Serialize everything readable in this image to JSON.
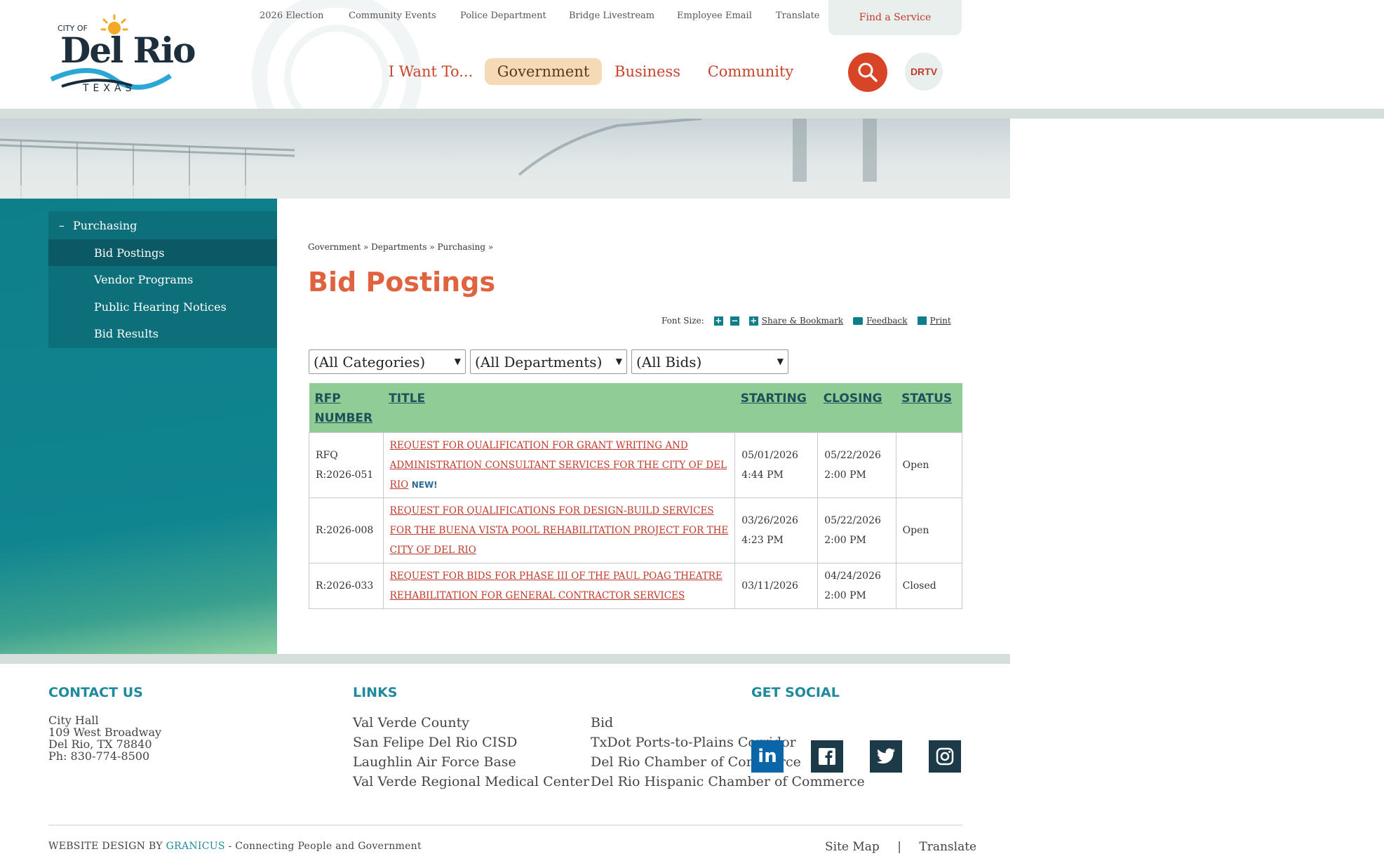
{
  "header": {
    "logo": {
      "line1": "CITY OF",
      "line2": "Del Rio",
      "line3": "TEXAS"
    },
    "utility_links": [
      "2026 Election",
      "Community Events",
      "Police Department",
      "Bridge Livestream",
      "Employee Email",
      "Translate"
    ],
    "find_service": "Find a Service",
    "main_nav": [
      "I Want To...",
      "Government",
      "Business",
      "Community"
    ],
    "drtv": "DRTV"
  },
  "sidebar": {
    "section": "Purchasing",
    "items": [
      "Bid Postings",
      "Vendor Programs",
      "Public Hearing Notices",
      "Bid Results"
    ]
  },
  "breadcrumb": [
    "Government",
    "Departments",
    "Purchasing"
  ],
  "page_title": "Bid Postings",
  "tools": {
    "font_size": "Font Size:",
    "share": "Share & Bookmark",
    "feedback": "Feedback",
    "print": "Print"
  },
  "filters": [
    "(All Categories)",
    "(All Departments)",
    "(All Bids)"
  ],
  "table": {
    "headers": [
      "RFP NUMBER",
      "TITLE",
      "STARTING",
      "CLOSING",
      "STATUS"
    ],
    "rows": [
      {
        "number": "RFQ R:2026-051",
        "title": "REQUEST FOR QUALIFICATION FOR GRANT WRITING AND ADMINISTRATION CONSULTANT SERVICES FOR THE CITY OF DEL RIO",
        "new": "NEW!",
        "start_date": "05/01/2026",
        "start_time": "4:44 PM",
        "close_date": "05/22/2026",
        "close_time": "2:00 PM",
        "status": "Open"
      },
      {
        "number": "R:2026-008",
        "title": "REQUEST FOR QUALIFICATIONS FOR DESIGN-BUILD SERVICES FOR THE BUENA VISTA POOL REHABILITATION PROJECT FOR THE CITY OF DEL RIO",
        "new": "",
        "start_date": "03/26/2026",
        "start_time": "4:23 PM",
        "close_date": "05/22/2026",
        "close_time": "2:00 PM",
        "status": "Open"
      },
      {
        "number": "R:2026-033",
        "title": "REQUEST FOR BIDS FOR PHASE III OF THE PAUL POAG THEATRE REHABILITATION FOR GENERAL CONTRACTOR SERVICES",
        "new": "",
        "start_date": "03/11/2026",
        "start_time": "",
        "close_date": "04/24/2026",
        "close_time": "2:00 PM",
        "status": "Closed"
      }
    ]
  },
  "footer": {
    "contact_heading": "CONTACT US",
    "contact_lines": [
      "City Hall",
      "109 West Broadway",
      "Del Rio, TX 78840",
      "Ph: 830-774-8500"
    ],
    "links_heading": "LINKS",
    "links_col1": [
      "Val Verde County",
      "San Felipe Del Rio CISD",
      "Laughlin Air Force Base",
      "Val Verde Regional Medical Center"
    ],
    "links_col2": [
      "Bid",
      "TxDot Ports-to-Plains Corridor",
      "Del Rio Chamber of Commerce",
      "Del Rio Hispanic Chamber of Commerce"
    ],
    "social_heading": "GET SOCIAL",
    "social": [
      "linkedin-icon",
      "facebook-icon",
      "twitter-icon",
      "instagram-icon"
    ],
    "credit_prefix": "WEBSITE DESIGN BY",
    "credit_brand": "GRANICUS",
    "credit_suffix": "- Connecting People and Government",
    "bottom_links": [
      "Site Map",
      "Translate"
    ]
  },
  "colors": {
    "accent": "#e0623e",
    "teal": "#0d7f8a",
    "table_header": "#90cc95",
    "search": "#d84526"
  }
}
